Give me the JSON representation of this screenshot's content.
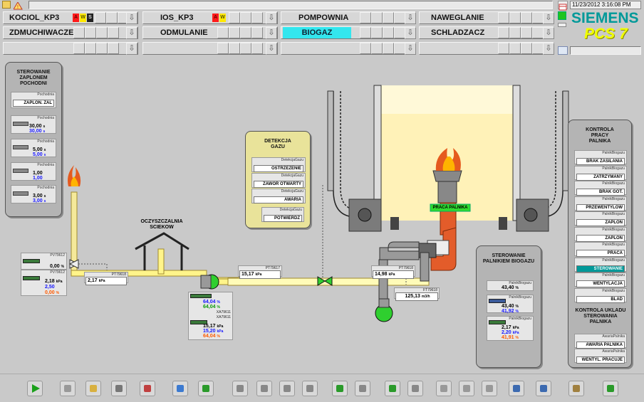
{
  "header": {
    "datetime": "11/23/2012 3:16:08 PM",
    "brand": "SIEMENS",
    "product": "PCS 7",
    "row1": [
      "KOCIOL_KP3",
      "IOS_KP3",
      "POMPOWNIA",
      "NAWEGLANIE"
    ],
    "row2": [
      "ZDMUCHIWACZE",
      "ODMULANIE",
      "BIOGAZ",
      "SCHLADZACZ"
    ],
    "alarm_letters": [
      "A",
      "W",
      "S"
    ],
    "colors": {
      "selected": "#33e6ee",
      "alarm_red": "#ff1a1a",
      "alarm_yellow": "#ffe800",
      "brand": "#009999",
      "product": "#f0ff00"
    }
  },
  "left_panel": {
    "title": "STEROWANIE ZAPLONEM POCHODNI",
    "items": [
      {
        "tag": "Pochodnia",
        "label": "ZAPLON. ZAL"
      },
      {
        "tag": "Pochodnia",
        "v1": "30,00",
        "u1": "s",
        "v2": "30,00",
        "u2": "s"
      },
      {
        "tag": "Pochodnia",
        "v1": "5,00",
        "u1": "s",
        "v2": "5,00",
        "u2": "s"
      },
      {
        "tag": "Pochodnia",
        "v1": "1,00",
        "u1": "",
        "v2": "1,00",
        "u2": ""
      },
      {
        "tag": "Pochodnia",
        "v1": "3,00",
        "u1": "s",
        "v2": "3,00",
        "u2": "s"
      }
    ]
  },
  "gas_panel": {
    "title": "DETEKCJA GAZU",
    "items": [
      {
        "tag": "DetekcjaGazu",
        "label": "OSTRZEZENIE"
      },
      {
        "tag": "DetekcjaGazu",
        "label": "ZAWOR OTWARTY"
      },
      {
        "tag": "DetekcjaGazu",
        "label": "AWARIA"
      },
      {
        "tag": "DetekcjaGazu",
        "label": "POTWIERDZ"
      }
    ]
  },
  "right_panel": {
    "title": "KONTROLA PRACY PALNIKA",
    "items": [
      {
        "tag": "PalnikBiogazu",
        "label": "BRAK ZASILANIA"
      },
      {
        "tag": "PalnikBiogazu",
        "label": "ZATRZYMANY"
      },
      {
        "tag": "PalnikBiogazu",
        "label": "BRAK GOT."
      },
      {
        "tag": "PalnikBiogazu",
        "label": "PRZEWENTYLOW"
      },
      {
        "tag": "PalnikBiogazu",
        "label": "ZAPLON"
      },
      {
        "tag": "PalnikBiogazu",
        "label": "ZAPLON"
      },
      {
        "tag": "PalnikBiogazu",
        "label": "PRACA"
      },
      {
        "tag": "PalnikBiogazu",
        "label": "STEROWANIE"
      },
      {
        "tag": "PalnikBiogazu",
        "label": "WENTYLACJA"
      },
      {
        "tag": "PalnikBiogazu",
        "label": "BLAD"
      }
    ],
    "title2": "KONTROLA UKLADU STEROWANIA PALNIKA",
    "items2": [
      {
        "tag": "AwariaPalnika",
        "label": "AWARIA PALNIKA"
      },
      {
        "tag": "AwariaPalnika",
        "label": "WENTYL. PRACUJE"
      }
    ]
  },
  "burner_panel": {
    "title": "STEROWANIE PALNIKIEM BIOGAZU",
    "items": [
      {
        "tag": "PalnikBiogazu",
        "v1": "43,40",
        "u1": "%"
      },
      {
        "tag": "PalnikBiogazu",
        "v1": "43,40",
        "u1": "%",
        "v2": "41,92",
        "u2": "%"
      },
      {
        "tag": "PalnikBiogazu",
        "v1": "2,17",
        "u1": "kPa",
        "v2": "2,20",
        "u2": "kPa",
        "v3": "41,91",
        "u3": "%"
      }
    ]
  },
  "process": {
    "plant_label": "OCZYSZCZALNIA SCIEKOW",
    "burner_status": "PRACA PALNIKA",
    "pv1": {
      "tag": "PV79612",
      "value": "0,00",
      "unit": "%"
    },
    "pv2": {
      "tag": "PV79612",
      "v1": "2,18",
      "v2": "2,50",
      "v3": "0,00",
      "unit1": "kPa",
      "unit3": "%"
    },
    "pt1": {
      "tag": "PT79618",
      "value": "2,17",
      "unit": "kPa"
    },
    "pt2": {
      "tag": "PT79617",
      "value": "15,17",
      "unit": "kPa"
    },
    "pt3": {
      "tag": "PT79618",
      "value": "14,98",
      "unit": "kPa"
    },
    "ft": {
      "tag": "FT79618",
      "value": "125,13",
      "unit": "m3/h"
    },
    "pump": {
      "v1": "64,04",
      "v2": "64,04",
      "unit": "%"
    },
    "xa1": "XA79611",
    "xa2": "XA79611",
    "xa_values": {
      "v1": "15,17",
      "v2": "15,20",
      "v3": "64,04",
      "u1": "kPa",
      "u2": "kPa",
      "u3": "%"
    }
  },
  "toolbar": {
    "buttons": [
      "start-icon",
      "tools-icon",
      "overview-icon",
      "grid-icon",
      "trend-icon",
      "thermometer-icon",
      "export-icon",
      "left-arrow-icon",
      "up-arrow-icon",
      "down-arrow-icon",
      "right-arrow-icon",
      "refresh-icon",
      "redo-icon",
      "import-icon",
      "forward-icon",
      "screen1-icon",
      "screen2-icon",
      "screen3-icon",
      "monitor-icon",
      "info-icon",
      "sound-icon",
      "acknowledge-icon"
    ]
  }
}
